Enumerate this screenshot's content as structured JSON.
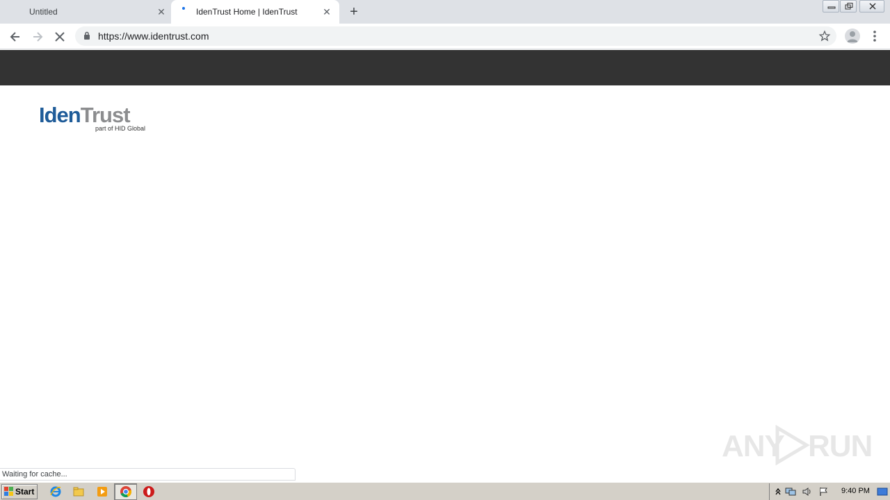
{
  "tabs": [
    {
      "title": "Untitled",
      "active": false
    },
    {
      "title": "IdenTrust Home | IdenTrust",
      "active": true
    }
  ],
  "toolbar": {
    "url": "https://www.identrust.com"
  },
  "logo": {
    "brand_part1": "Iden",
    "brand_part2": "Trust",
    "tagline": "part of HID Global",
    "colors": {
      "iden": "#1f5c99",
      "trust": "#8c8d8f"
    }
  },
  "page": {
    "topbar_color": "#333333"
  },
  "status_bar": {
    "text": "Waiting for cache..."
  },
  "watermark": {
    "text_left": "ANY",
    "text_right": "RUN"
  },
  "taskbar": {
    "start_label": "Start",
    "clock": "9:40 PM",
    "pinned_icons": [
      "internet-explorer-icon",
      "file-explorer-icon",
      "media-player-icon",
      "chrome-icon",
      "opera-icon"
    ]
  }
}
